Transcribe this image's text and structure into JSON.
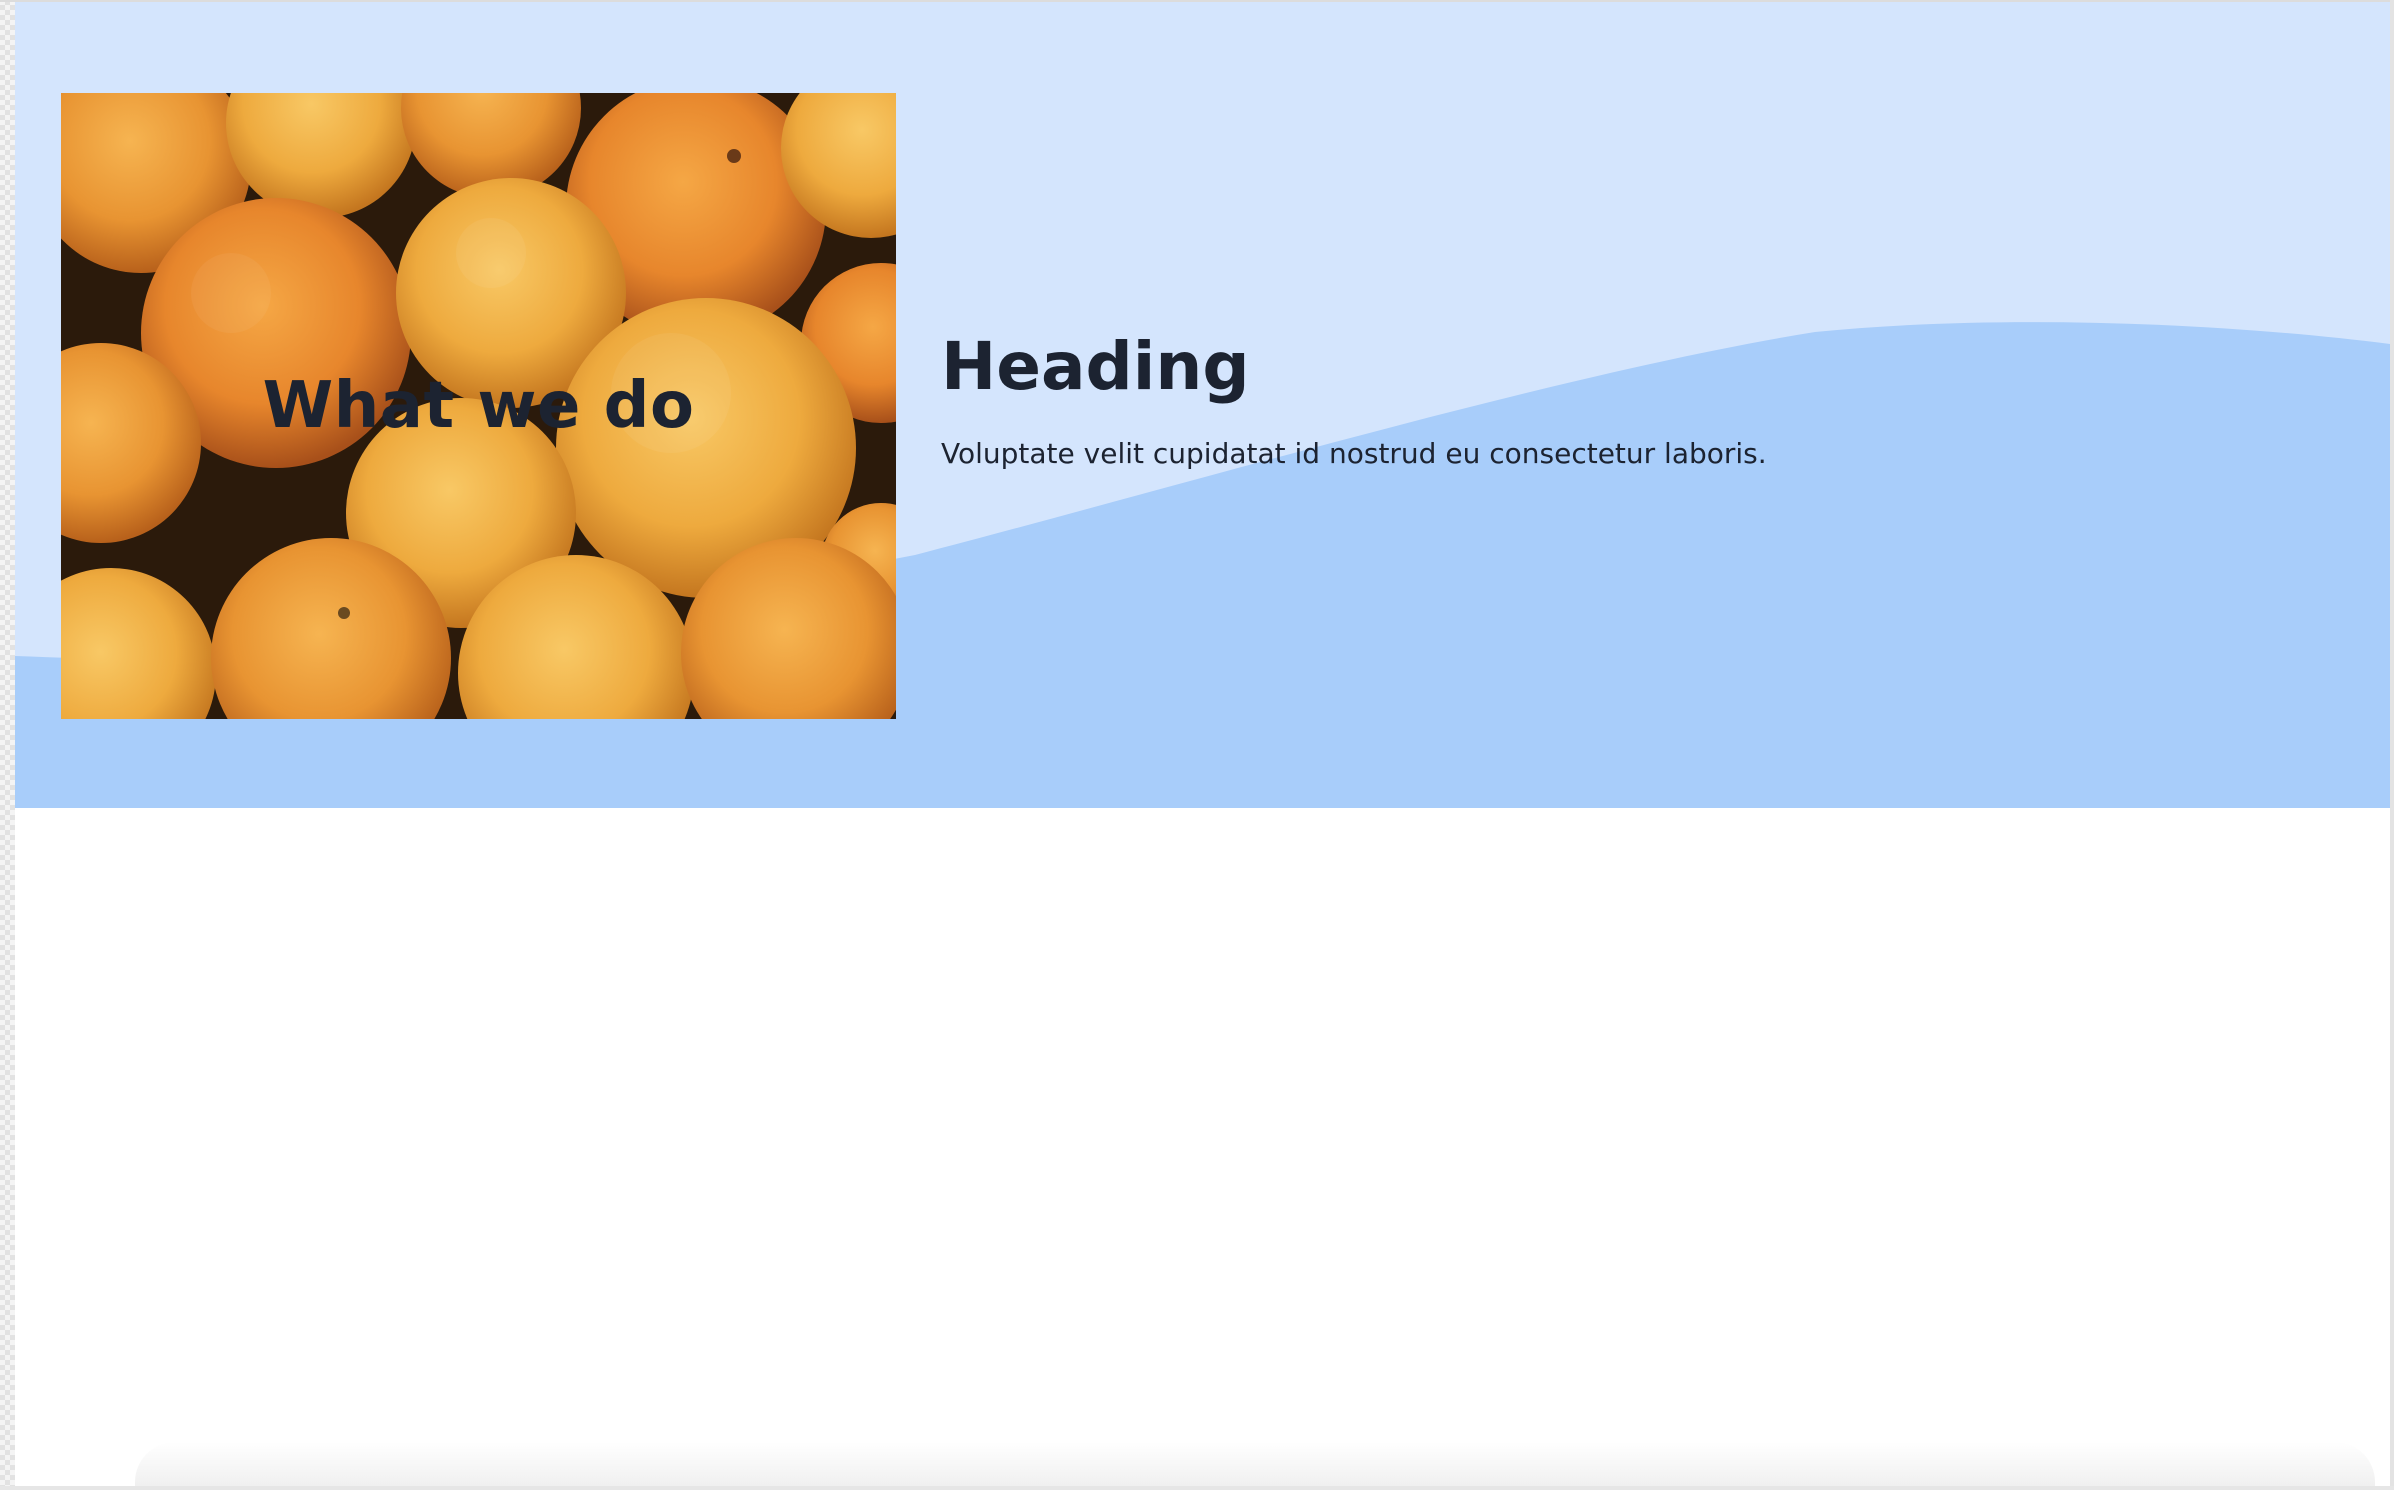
{
  "hero": {
    "media": {
      "title": "What we do",
      "image_name": "oranges-photo"
    },
    "heading": "Heading",
    "body": "Voluptate velit cupidatat id nostrud eu consectetur laboris."
  },
  "colors": {
    "hero_light": "#d4e5fd",
    "hero_wave": "#a8cdfa",
    "text_dark": "#1c2331",
    "page_bg": "#ffffff"
  }
}
